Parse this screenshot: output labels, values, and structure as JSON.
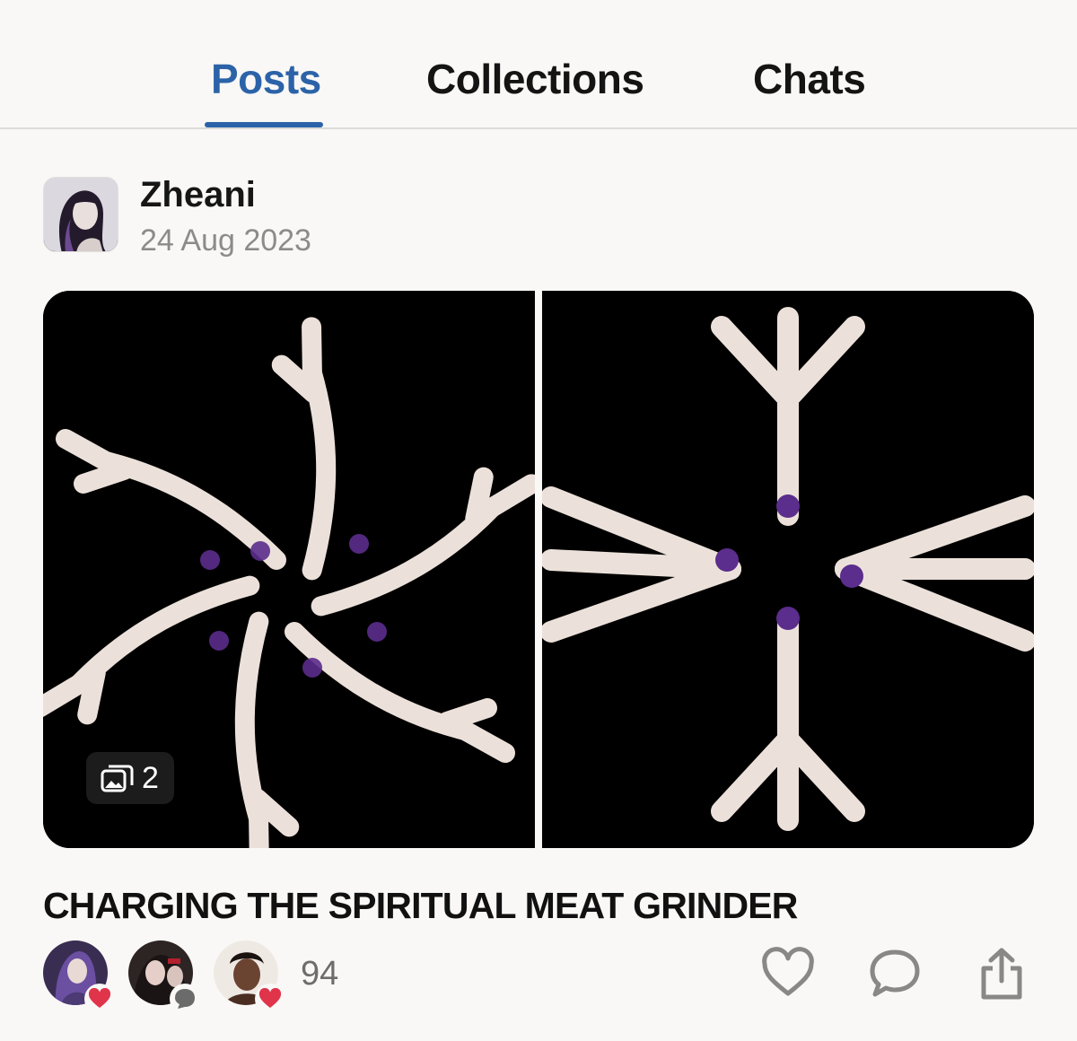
{
  "tabs": [
    {
      "label": "Posts",
      "active": true
    },
    {
      "label": "Collections",
      "active": false
    },
    {
      "label": "Chats",
      "active": false
    }
  ],
  "post": {
    "author": "Zheani",
    "date": "24 Aug 2023",
    "image_count": "2",
    "title": "CHARGING THE SPIRITUAL MEAT GRINDER",
    "reaction_count": "94",
    "reactors": [
      {
        "reaction": "heart-icon"
      },
      {
        "reaction": "comment-icon"
      },
      {
        "reaction": "heart-icon"
      }
    ],
    "actions": [
      "heart-icon",
      "comment-icon",
      "share-icon"
    ]
  },
  "colors": {
    "accent": "#2c63a8",
    "background": "#f9f8f6",
    "like_red": "#e0344b",
    "muted_text": "#8d8b88"
  }
}
